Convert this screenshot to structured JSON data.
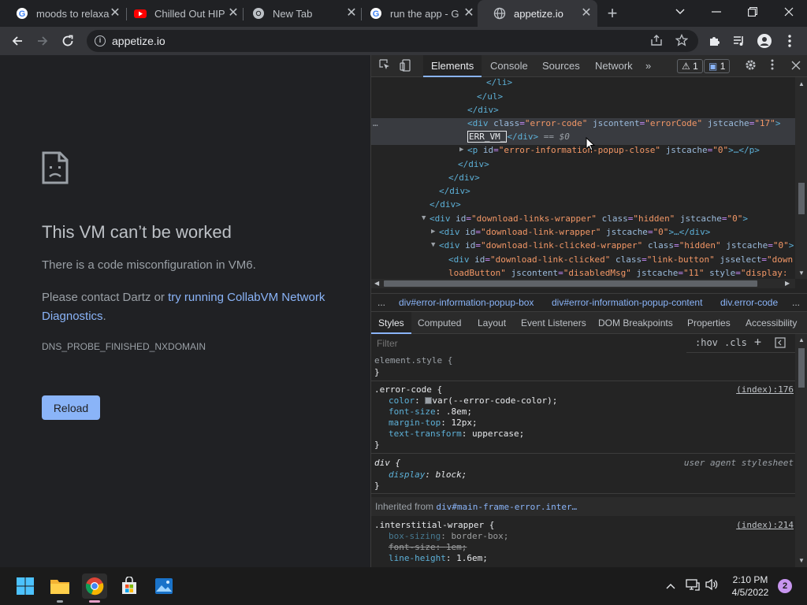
{
  "browser": {
    "tabs": [
      {
        "title": "moods to relaxa",
        "favicon": "google-icon",
        "active": false
      },
      {
        "title": "Chilled Out HIP",
        "favicon": "youtube-icon",
        "active": false
      },
      {
        "title": "New Tab",
        "favicon": "chrome-icon",
        "active": false
      },
      {
        "title": "run the app - G",
        "favicon": "google-icon",
        "active": false
      },
      {
        "title": "appetize.io",
        "favicon": "globe-icon",
        "active": true
      }
    ],
    "close_glyph": "✕",
    "new_tab_glyph": "+",
    "url": "appetize.io"
  },
  "page": {
    "title": "This VM can’t be worked",
    "description": "There is a code misconfiguration in VM6.",
    "contact_prefix": "Please contact Dartz or ",
    "contact_link": "try running CollabVM Network Diagnostics",
    "contact_suffix": ".",
    "error_code": "DNS_PROBE_FINISHED_NXDOMAIN",
    "reload_label": "Reload"
  },
  "devtools": {
    "tabs": [
      "Elements",
      "Console",
      "Sources",
      "Network"
    ],
    "more_tabs": "»",
    "warnings_count": "1",
    "messages_count": "1",
    "dom": {
      "l1": "</li>",
      "l2": "</ul>",
      "l3": "</div>",
      "l4_open": "<div",
      "l4_a1": "class",
      "l4_v1": "\"error-code\"",
      "l4_a2": "jscontent",
      "l4_v2": "\"errorCode\"",
      "l4_a3": "jstcache",
      "l4_v3": "\"17\"",
      "l4_close": ">",
      "sel_text": "ERR_VM_",
      "sel_end": "</div>",
      "sel_marker": "== $0",
      "l6_open": "<p",
      "l6_a1": "id",
      "l6_v1": "\"error-information-popup-close\"",
      "l6_a2": "jstcache",
      "l6_v2": "\"0\"",
      "l6_close": ">…</p>",
      "l7": "</div>",
      "l8": "</div>",
      "l9": "</div>",
      "l10": "</div>",
      "l11_open": "<div",
      "l11_a1": "id",
      "l11_v1": "\"download-links-wrapper\"",
      "l11_a2": "class",
      "l11_v2": "\"hidden\"",
      "l11_a3": "jstcache",
      "l11_v3": "\"0\"",
      "l11_close": ">",
      "l12_open": "<div",
      "l12_a1": "id",
      "l12_v1": "\"download-link-wrapper\"",
      "l12_a2": "jstcache",
      "l12_v2": "\"0\"",
      "l12_close": ">…</div>",
      "l13_open": "<div",
      "l13_a1": "id",
      "l13_v1": "\"download-link-clicked-wrapper\"",
      "l13_a2": "class",
      "l13_v2": "\"hidden\"",
      "l13_a3": "jstcache",
      "l13_v3": "\"0\"",
      "l13_close": ">",
      "l14_open": "<div",
      "l14_a1": "id",
      "l14_v1": "\"download-link-clicked\"",
      "l14_a2": "class",
      "l14_v2": "\"link-button\"",
      "l14_a3": "jsselect",
      "l14_v3": "\"down",
      "l15_v1": "loadButton\"",
      "l15_a2": "jscontent",
      "l15_v2": "\"disabledMsg\"",
      "l15_a3": "jstcache",
      "l15_v3": "\"11\"",
      "l15_a4": "style",
      "l15_v4": "\"display:"
    },
    "breadcrumbs": [
      "...",
      "div#error-information-popup-box",
      "div#error-information-popup-content",
      "div.error-code",
      "..."
    ],
    "sub_tabs": [
      "Styles",
      "Computed",
      "Layout",
      "Event Listeners",
      "DOM Breakpoints",
      "Properties",
      "Accessibility"
    ],
    "filter_placeholder": "Filter",
    "hov": ":hov",
    "cls": ".cls",
    "styles": {
      "element_style": "element.style {",
      "close_brace": "}",
      "r1_selector": ".error-code {",
      "r1_source": "(index):176",
      "r1_p1": "color",
      "r1_v1": "var(--error-code-color);",
      "r1_p2": "font-size",
      "r1_v2": ".8em;",
      "r1_p3": "margin-top",
      "r1_v3": "12px;",
      "r1_p4": "text-transform",
      "r1_v4": "uppercase;",
      "r2_selector": "div {",
      "r2_source": "user agent stylesheet",
      "r2_p1": "display",
      "r2_v1": "block;",
      "inherited_label": "Inherited from ",
      "inherited_from": "div#main-frame-error.inter…",
      "r3_selector": ".interstitial-wrapper {",
      "r3_source": "(index):214",
      "r3_p1": "box-sizing",
      "r3_v1": "border-box;",
      "r3_p2": "font-size",
      "r3_v2": "1em;",
      "r3_p3": "line-height",
      "r3_v3": "1.6em;"
    }
  },
  "taskbar": {
    "time": "2:10 PM",
    "date": "4/5/2022",
    "notification_count": "2"
  },
  "colors": {
    "accent": "#8ab4f8",
    "page_bg": "#202124"
  }
}
